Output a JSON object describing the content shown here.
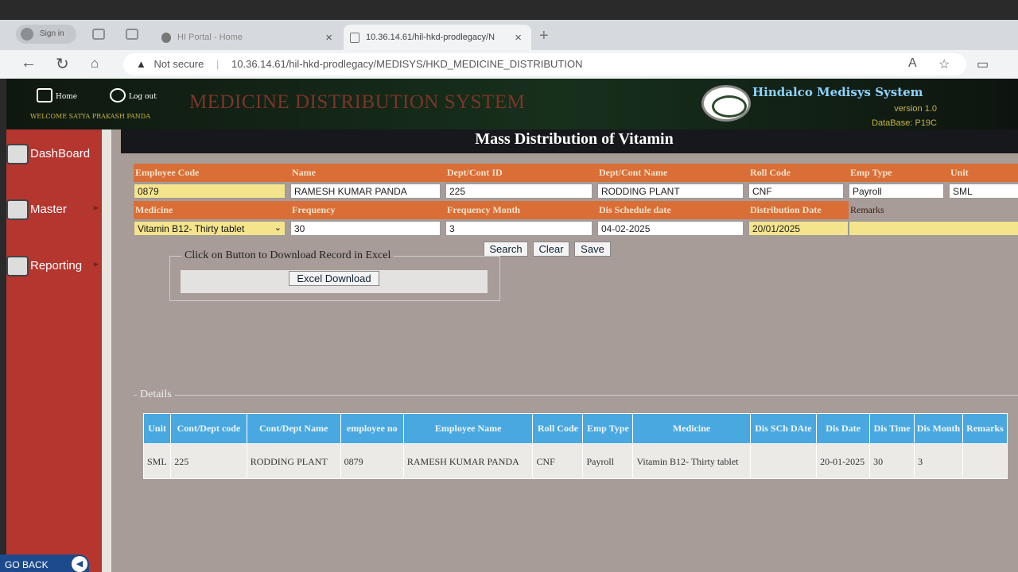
{
  "browser": {
    "signin_label": "Sign in",
    "tabs": [
      {
        "title": "HI Portal - Home"
      },
      {
        "title": "10.36.14.61/hil-hkd-prodlegacy/N"
      }
    ],
    "security_label": "Not secure",
    "url": "10.36.14.61/hil-hkd-prodlegacy/MEDISYS/HKD_MEDICINE_DISTRIBUTION"
  },
  "header": {
    "home_label": "Home",
    "logout_label": "Log out",
    "welcome_text": "WELCOME SATYA PRAKASH PANDA",
    "app_title": "MEDICINE DISTRIBUTION SYSTEM",
    "brand": "Hindalco Medisys System",
    "version": "version 1.0",
    "database": "DataBase: P19C"
  },
  "sidebar": {
    "items": [
      {
        "label": "DashBoard",
        "icon": "dashboard-gauge-icon"
      },
      {
        "label": "Master",
        "icon": "gears-icon"
      },
      {
        "label": "Reporting",
        "icon": "report-gears-icon"
      }
    ],
    "goback_label": "GO BACK"
  },
  "page_title": "Mass Distribution of Vitamin",
  "form": {
    "row1_labels": [
      "Employee Code",
      "Name",
      "Dept/Cont ID",
      "Dept/Cont Name",
      "Roll Code",
      "Emp Type",
      "Unit"
    ],
    "row1_values": [
      "0879",
      "RAMESH KUMAR PANDA",
      "225",
      "RODDING PLANT",
      "CNF",
      "Payroll",
      "SML"
    ],
    "row2_labels": [
      "Medicine",
      "Frequency",
      "Frequency Month",
      "Dis Schedule date",
      "Distribution Date",
      "Remarks"
    ],
    "medicine_selected": "Vitamin B12- Thirty tablet",
    "frequency": "30",
    "frequency_month": "3",
    "dis_schedule_date": "04-02-2025",
    "distribution_date": "20/01/2025",
    "remarks": ""
  },
  "buttons": {
    "search": "Search",
    "clear": "Clear",
    "save": "Save"
  },
  "download": {
    "legend": "Click on Button to Download Record in Excel",
    "button_label": "Excel Download"
  },
  "details": {
    "legend": "Details",
    "columns": [
      "Unit",
      "Cont/Dept code",
      "Cont/Dept Name",
      "employee no",
      "Employee Name",
      "Roll Code",
      "Emp Type",
      "Medicine",
      "Dis SCh DAte",
      "Dis Date",
      "Dis Time",
      "Dis Month",
      "Remarks"
    ],
    "rows": [
      [
        "SML",
        "225",
        "RODDING PLANT",
        "0879",
        "RAMESH KUMAR PANDA",
        "CNF",
        "Payroll",
        "Vitamin B12- Thirty tablet",
        "",
        "20-01-2025",
        "30",
        "3",
        ""
      ]
    ]
  }
}
